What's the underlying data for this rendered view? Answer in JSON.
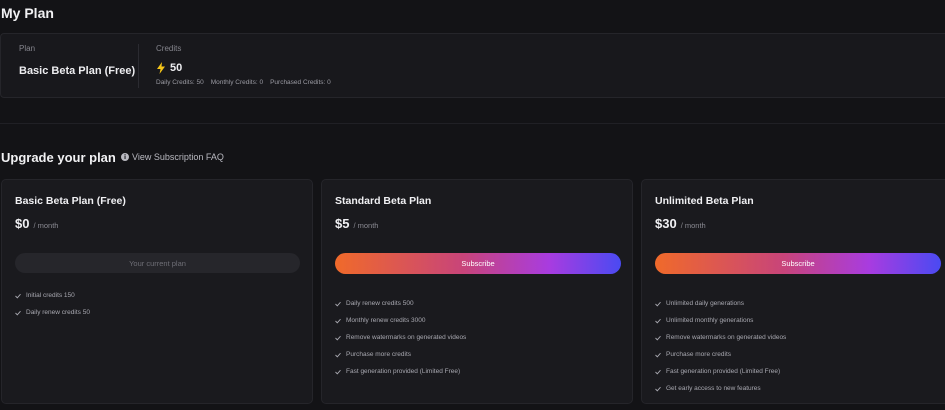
{
  "my_plan": {
    "title": "My Plan",
    "plan_label": "Plan",
    "plan_name": "Basic Beta Plan (Free)",
    "credits_label": "Credits",
    "credits_value": "50",
    "daily_credits": "Daily Credits: 50",
    "monthly_credits": "Monthly Credits: 0",
    "purchased_credits": "Purchased Credits: 0"
  },
  "upgrade": {
    "title": "Upgrade your plan",
    "faq_link": "View Subscription FAQ"
  },
  "plans": [
    {
      "name": "Basic Beta Plan (Free)",
      "price": "$0",
      "period": "/ month",
      "button": "Your current plan",
      "features": [
        "Initial credits 150",
        "Daily renew credits 50"
      ]
    },
    {
      "name": "Standard Beta Plan",
      "price": "$5",
      "period": "/ month",
      "button": "Subscribe",
      "features": [
        "Daily renew credits 500",
        "Monthly renew credits 3000",
        "Remove watermarks on generated videos",
        "Purchase more credits",
        "Fast generation provided (Limited Free)"
      ]
    },
    {
      "name": "Unlimited Beta Plan",
      "price": "$30",
      "period": "/ month",
      "button": "Subscribe",
      "features": [
        "Unlimited daily generations",
        "Unlimited monthly generations",
        "Remove watermarks on generated videos",
        "Purchase more credits",
        "Fast generation provided (Limited Free)",
        "Get early access to new features"
      ]
    }
  ],
  "icons": {
    "credits": "lightning-bolt-icon",
    "faq": "info-icon",
    "feature": "check-icon"
  },
  "colors": {
    "bolt": "#f5c518",
    "subscribe_gradient": [
      "#f06a2a",
      "#c8447a",
      "#a83ce0",
      "#4a4af2"
    ]
  }
}
